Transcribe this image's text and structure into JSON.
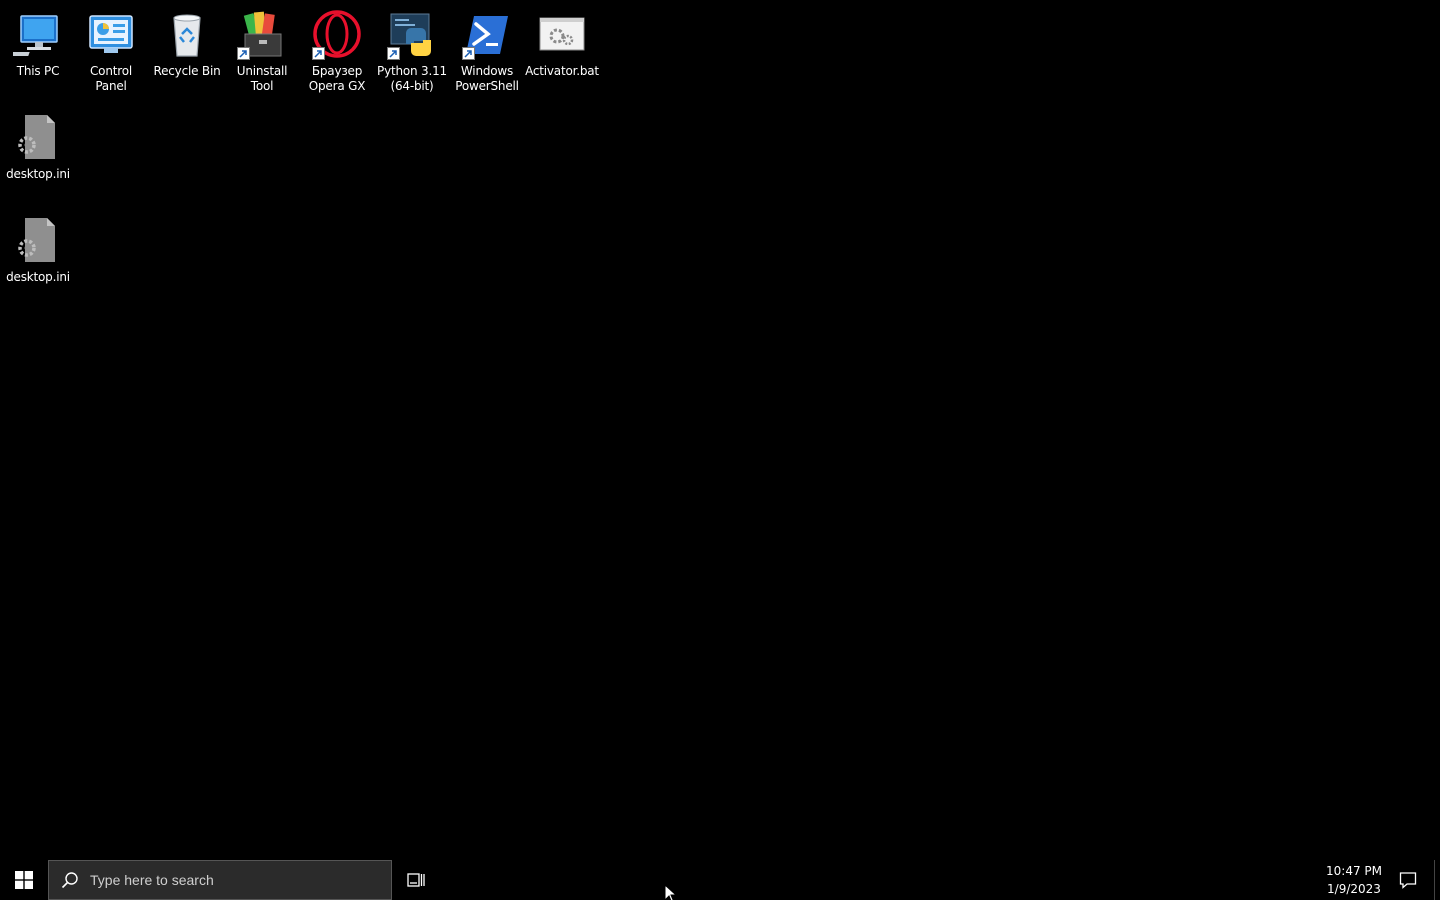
{
  "desktop": {
    "icons": [
      {
        "label": "This PC",
        "icon": "computer-icon"
      },
      {
        "label": "Control\nPanel",
        "icon": "control-panel-icon"
      },
      {
        "label": "Recycle Bin",
        "icon": "recycle-bin-icon"
      },
      {
        "label": "Uninstall Tool",
        "icon": "uninstall-tool-icon"
      },
      {
        "label": "Браузер\nOpera GX",
        "icon": "opera-gx-icon"
      },
      {
        "label": "Python 3.11\n(64-bit)",
        "icon": "python-icon"
      },
      {
        "label": "Windows\nPowerShell",
        "icon": "powershell-icon"
      },
      {
        "label": "Activator.bat",
        "icon": "batch-file-icon"
      },
      {
        "label": "desktop.ini",
        "icon": "settings-file-icon"
      },
      {
        "label": "desktop.ini",
        "icon": "settings-file-icon"
      }
    ]
  },
  "taskbar": {
    "start_icon": "windows-logo-icon",
    "search_placeholder": "Type here to search",
    "taskview_icon": "task-view-icon",
    "clock": {
      "time": "10:47 PM",
      "date": "1/9/2023"
    },
    "notification_icon": "action-center-icon"
  },
  "colors": {
    "background": "#000000",
    "search_box": "#2b2b2b",
    "opera_red": "#e8102c",
    "powershell_blue": "#2a6fd6",
    "python_blue": "#3775a9",
    "python_yellow": "#ffd343"
  }
}
